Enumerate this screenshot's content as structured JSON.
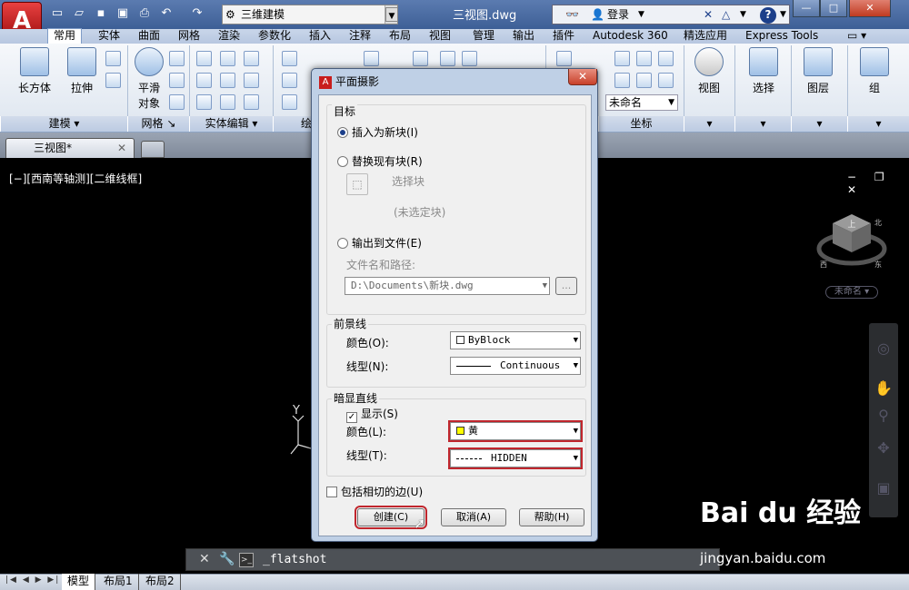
{
  "window": {
    "title": "三视图.dwg",
    "workspace": "三维建模"
  },
  "search": {
    "login": "登录"
  },
  "ribbon_tabs": [
    "常用",
    "实体",
    "曲面",
    "网格",
    "渲染",
    "参数化",
    "插入",
    "注释",
    "布局",
    "视图",
    "管理",
    "输出",
    "插件",
    "Autodesk 360",
    "精选应用",
    "Express Tools"
  ],
  "ribbon": {
    "btn_box": "长方体",
    "btn_extrude": "拉伸",
    "btn_smooth1": "平滑",
    "btn_smooth2": "对象",
    "btn_view": "视图",
    "btn_select": "选择",
    "btn_layer": "图层",
    "btn_group": "组",
    "panel_modeling": "建模",
    "panel_mesh": "网格",
    "panel_solidedit": "实体编辑",
    "panel_draw_partial": "绘",
    "panel_coords_partial": "坐标",
    "unnamed_combo": "未命名"
  },
  "doc_tab": {
    "name": "三视图*"
  },
  "viewport": {
    "label": "[−][西南等轴测][二维线框]",
    "unnamed_badge": "未命名",
    "cube_top": "上",
    "cube_north": "北",
    "cube_west": "西",
    "cube_east": "东"
  },
  "ucs": {
    "y": "Y"
  },
  "command": {
    "text": "_flatshot"
  },
  "layout_tabs": [
    "模型",
    "布局1",
    "布局2"
  ],
  "dialog": {
    "title": "平面摄影",
    "target_label": "目标",
    "opt_insert": "插入为新块(I)",
    "opt_replace": "替换现有块(R)",
    "select_block": "选择块",
    "no_block": "(未选定块)",
    "opt_export": "输出到文件(E)",
    "file_path_label": "文件名和路径:",
    "file_path": "D:\\Documents\\新块.dwg",
    "browse": "...",
    "foreground_label": "前景线",
    "fg_color_label": "颜色(O):",
    "fg_color": "ByBlock",
    "fg_linetype_label": "线型(N):",
    "fg_linetype": "Continuous",
    "obscured_label": "暗显直线",
    "show_label": "显示(S)",
    "ob_color_label": "颜色(L):",
    "ob_color": "黄",
    "ob_linetype_label": "线型(T):",
    "ob_linetype": "HIDDEN",
    "tangent_label": "包括相切的边(U)",
    "btn_create": "创建(C)",
    "btn_cancel": "取消(A)",
    "btn_help": "帮助(H)"
  },
  "watermark": {
    "brand": "Bai du 经验",
    "url": "jingyan.baidu.com"
  },
  "colors": {
    "highlight": "#c0262d",
    "yellow": "#ffff00"
  }
}
